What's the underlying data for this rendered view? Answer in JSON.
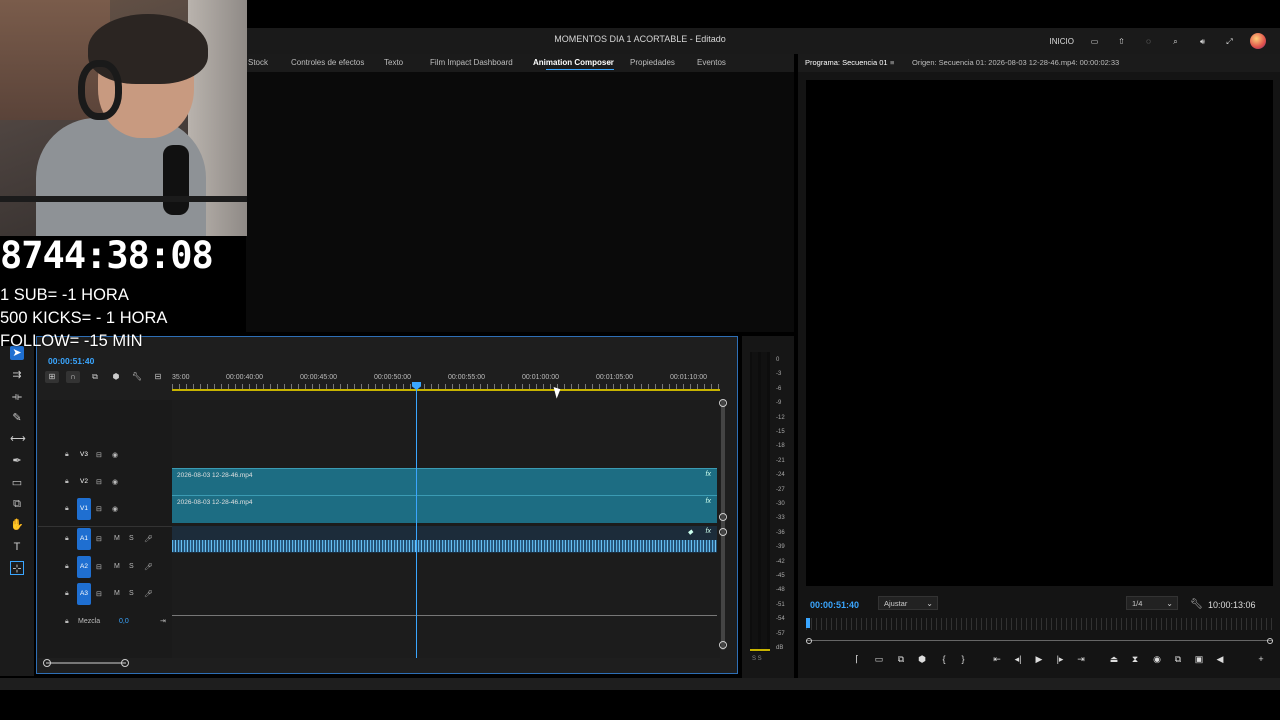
{
  "window": {
    "title": "MOMENTOS DIA 1 ACORTABLE - Editado",
    "workspace_label": "INICIO"
  },
  "panel_tabs": [
    "Stock",
    "Controles de efectos",
    "Texto",
    "Film Impact Dashboard",
    "Animation Composer",
    "Propiedades",
    "Eventos"
  ],
  "active_panel_tab": "Animation Composer",
  "program_monitor": {
    "tab_label": "Programa: Secuencia 01",
    "source_label": "Origen: Secuencia 01: 2026-08-03 12-28-46.mp4: 00:00:02:33",
    "timecode": "00:00:51:40",
    "fit_select": "Ajustar",
    "resolution_select": "1/4",
    "duration": "10:00:13:06"
  },
  "timeline": {
    "timecode": "00:00:51:40",
    "ruler_labels": [
      "35:00",
      "00:00:40:00",
      "00:00:45:00",
      "00:00:50:00",
      "00:00:55:00",
      "00:01:00:00",
      "00:01:05:00",
      "00:01:10:00"
    ],
    "video_tracks": [
      "V3",
      "V2",
      "V1"
    ],
    "audio_tracks": [
      "A1",
      "A2",
      "A3"
    ],
    "mix_label": "Mezcla",
    "mix_value": "0,0",
    "clips": {
      "v2": "2026-08-03 12-28-46.mp4",
      "v1": "2026-08-03 12-28-46.mp4",
      "fx_badge": "fx"
    }
  },
  "meter": {
    "labels": [
      "0",
      "-3",
      "-6",
      "-9",
      "-12",
      "-15",
      "-18",
      "-21",
      "-24",
      "-27",
      "-30",
      "-33",
      "-36",
      "-39",
      "-42",
      "-45",
      "-48",
      "-51",
      "-54",
      "-57",
      "dB"
    ],
    "bottom": "S  S"
  },
  "stream_overlay": {
    "countdown": "8744:38:08",
    "lines": [
      "1 SUB= -1 HORA",
      "500 KICKS= - 1 HORA",
      "FOLLOW= -15 MIN"
    ]
  },
  "colors": {
    "accent_blue": "#3aa6ff",
    "clip_teal": "#1d6d83",
    "work_area_yellow": "#c8b400"
  }
}
